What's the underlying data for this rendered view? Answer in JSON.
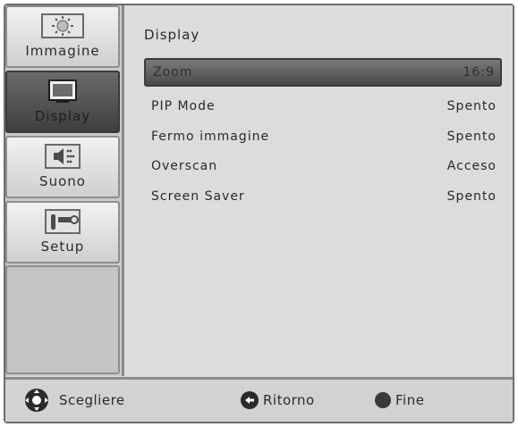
{
  "tabs": [
    {
      "label": "Immagine",
      "icon": "sun-icon"
    },
    {
      "label": "Display",
      "icon": "monitor-icon"
    },
    {
      "label": "Suono",
      "icon": "speaker-icon"
    },
    {
      "label": "Setup",
      "icon": "tools-icon"
    }
  ],
  "panel": {
    "title": "Display",
    "rows": [
      {
        "name": "Zoom",
        "value": "16:9"
      },
      {
        "name": "PIP Mode",
        "value": "Spento"
      },
      {
        "name": "Fermo immagine",
        "value": "Spento"
      },
      {
        "name": "Overscan",
        "value": "Acceso"
      },
      {
        "name": "Screen Saver",
        "value": "Spento"
      }
    ]
  },
  "footer": {
    "select": "Scegliere",
    "back": "Ritorno",
    "exit": "Fine"
  },
  "colors": {
    "active_tab": "#4f4f4f",
    "selected_row": "#5c5c5c"
  }
}
